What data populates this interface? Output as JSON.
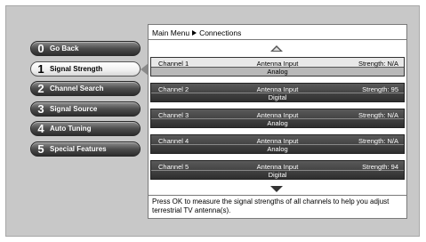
{
  "menu": {
    "items": [
      {
        "num": "0",
        "label": "Go Back"
      },
      {
        "num": "1",
        "label": "Signal Strength"
      },
      {
        "num": "2",
        "label": "Channel Search"
      },
      {
        "num": "3",
        "label": "Signal Source"
      },
      {
        "num": "4",
        "label": "Auto Tuning"
      },
      {
        "num": "5",
        "label": "Special Features"
      }
    ],
    "active_index": 1
  },
  "breadcrumb": {
    "root": "Main Menu",
    "current": "Connections"
  },
  "channels": [
    {
      "name": "Channel 1",
      "source": "Antenna Input",
      "strength": "Strength: N/A",
      "type": "Analog"
    },
    {
      "name": "Channel 2",
      "source": "Antenna Input",
      "strength": "Strength: 95",
      "type": "Digital"
    },
    {
      "name": "Channel 3",
      "source": "Antenna Input",
      "strength": "Strength: N/A",
      "type": "Analog"
    },
    {
      "name": "Channel 4",
      "source": "Antenna Input",
      "strength": "Strength: N/A",
      "type": "Analog"
    },
    {
      "name": "Channel 5",
      "source": "Antenna Input",
      "strength": "Strength: 94",
      "type": "Digital"
    }
  ],
  "selected_channel_index": 0,
  "help_text": "Press OK to measure the signal strengths of all channels to help you adjust terrestrial TV antenna(s)."
}
